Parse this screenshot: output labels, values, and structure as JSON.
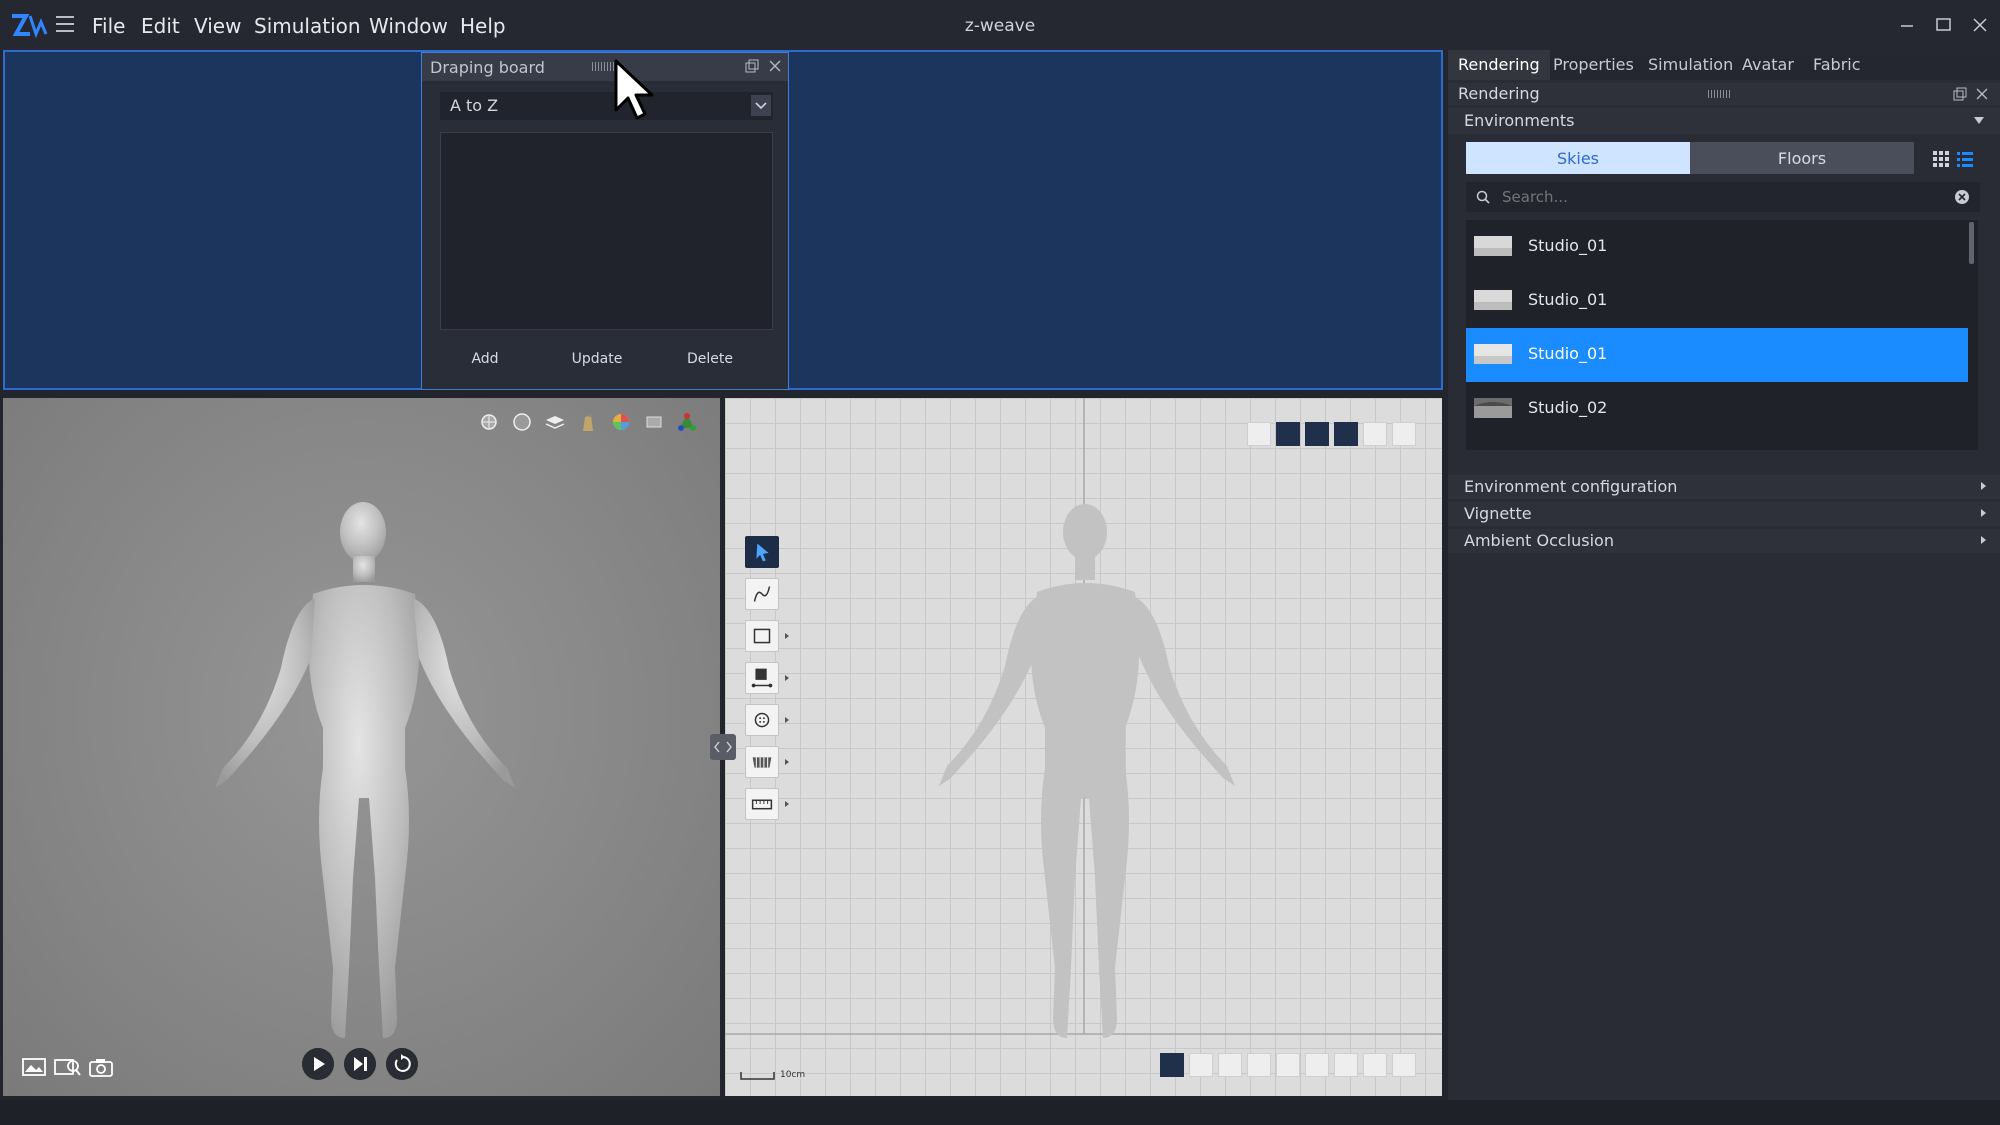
{
  "window": {
    "title": "z-weave",
    "menu": [
      "File",
      "Edit",
      "View",
      "Simulation",
      "Window",
      "Help"
    ]
  },
  "draping_board": {
    "title": "Draping board",
    "sort_value": "A to Z",
    "buttons": {
      "add": "Add",
      "update": "Update",
      "delete": "Delete"
    }
  },
  "viewport_3d": {
    "icons": [
      "sun-icon",
      "sphere-icon",
      "layers-icon",
      "hanger-icon",
      "color-wheel-icon",
      "texture-icon",
      "axes-icon"
    ],
    "bottom_left_icons": [
      "image-icon",
      "image-search-icon",
      "camera-icon"
    ],
    "playback": [
      "play-icon",
      "step-forward-icon",
      "reset-icon"
    ]
  },
  "viewport_2d": {
    "scale_label": "10cm",
    "tools": [
      "select-pointer-icon",
      "curve-icon",
      "rectangle-icon",
      "sewing-icon",
      "button-icon",
      "fold-icon",
      "ruler-icon"
    ]
  },
  "right_panel": {
    "tabs": [
      "Rendering",
      "Properties",
      "Simulation",
      "Avatar",
      "Fabric"
    ],
    "active_tab": "Rendering",
    "subheader": "Rendering",
    "environments": {
      "header": "Environments",
      "toggle": {
        "skies": "Skies",
        "floors": "Floors"
      },
      "search_placeholder": "Search...",
      "items": [
        {
          "name": "Studio_01",
          "selected": false
        },
        {
          "name": "Studio_01",
          "selected": false
        },
        {
          "name": "Studio_01",
          "selected": true
        },
        {
          "name": "Studio_02",
          "selected": false
        }
      ]
    },
    "sections": [
      "Environment configuration",
      "Vignette",
      "Ambient Occlusion"
    ]
  },
  "colors": {
    "accent": "#1a8cff",
    "drop_zone": "#1c355c",
    "panel_bg": "#292c35"
  }
}
